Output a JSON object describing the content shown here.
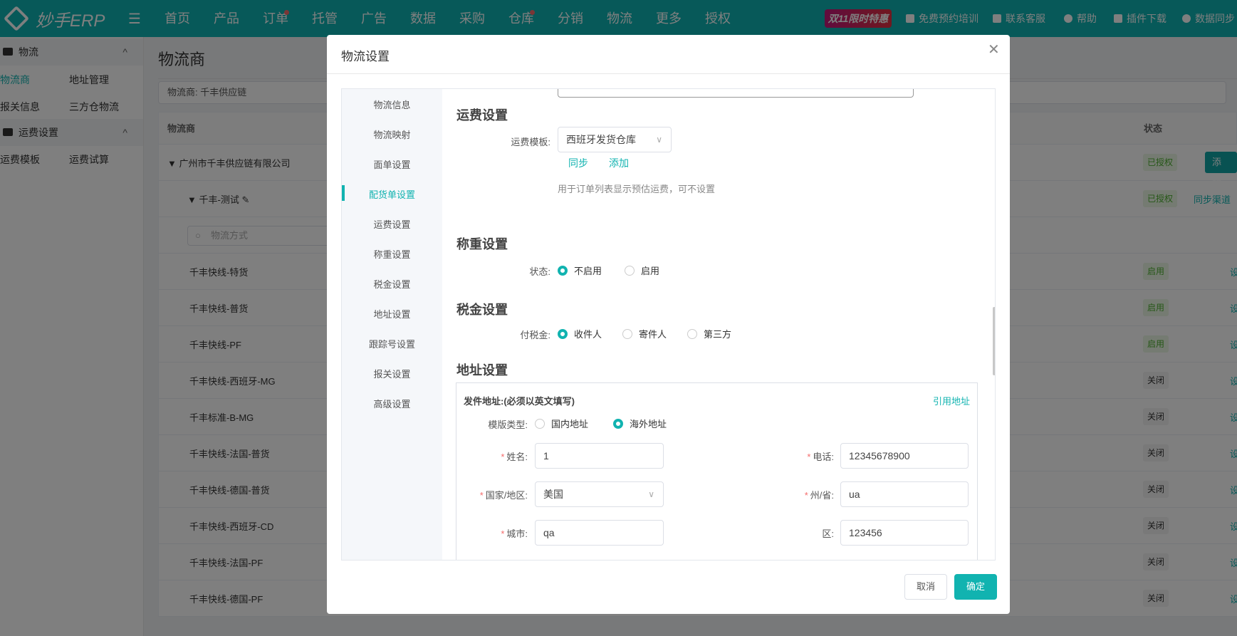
{
  "topbar": {
    "brand": "妙手ERP",
    "nav": [
      {
        "label": "首页"
      },
      {
        "label": "产品"
      },
      {
        "label": "订单",
        "dot": true
      },
      {
        "label": "托管"
      },
      {
        "label": "广告"
      },
      {
        "label": "数据"
      },
      {
        "label": "采购"
      },
      {
        "label": "仓库",
        "dot": true
      },
      {
        "label": "分销"
      },
      {
        "label": "物流"
      },
      {
        "label": "更多"
      },
      {
        "label": "授权"
      }
    ],
    "promo": "双11限时特惠",
    "links": [
      "免费预约培训",
      "联系客服",
      "帮助",
      "插件下载",
      "数据同步"
    ]
  },
  "sidebar": {
    "groups": [
      {
        "label": "物流",
        "icon": "truck-icon"
      },
      {
        "label": "运费设置",
        "icon": "truck-icon"
      }
    ],
    "items": [
      "物流商",
      "地址管理",
      "报关信息",
      "三方仓物流",
      "运费模板",
      "运费试算"
    ]
  },
  "main": {
    "title": "物流商",
    "filter": "物流商:   千丰供应链",
    "col_name": "物流商",
    "col_status": "状态",
    "company": "广州市千丰供应链有限公司",
    "company_status": "已授权",
    "add_auth": "添加授权",
    "account": "千丰-测试",
    "account_status": "已授权",
    "sync_channel": "同步渠道",
    "search_placeholder": "物流方式",
    "set_label": "设",
    "rows": [
      {
        "name": "千丰快线-特货",
        "status": "启用",
        "on": true
      },
      {
        "name": "千丰快线-普货",
        "status": "启用",
        "on": true
      },
      {
        "name": "千丰快线-PF",
        "status": "启用",
        "on": true
      },
      {
        "name": "千丰快线-西班牙-MG",
        "status": "关闭",
        "on": false
      },
      {
        "name": "千丰标准-B-MG",
        "status": "关闭",
        "on": false
      },
      {
        "name": "千丰快线-法国-普货",
        "status": "关闭",
        "on": false
      },
      {
        "name": "千丰快线-德国-普货",
        "status": "关闭",
        "on": false
      },
      {
        "name": "千丰快线-西班牙-CD",
        "status": "关闭",
        "on": false
      },
      {
        "name": "千丰快线-法国-PF",
        "status": "关闭",
        "on": false
      },
      {
        "name": "千丰快线-德国-PF",
        "status": "关闭",
        "on": false
      }
    ]
  },
  "modal": {
    "title": "物流设置",
    "nav": [
      "物流信息",
      "物流映射",
      "面单设置",
      "配货单设置",
      "运费设置",
      "称重设置",
      "税金设置",
      "地址设置",
      "跟踪号设置",
      "报关设置",
      "高级设置"
    ],
    "active_nav": 3,
    "freight": {
      "heading": "运费设置",
      "label": "运费模板:",
      "value": "西班牙发货仓库",
      "sync": "同步",
      "add": "添加",
      "hint": "用于订单列表显示预估运费，可不设置"
    },
    "weigh": {
      "heading": "称重设置",
      "label": "状态:",
      "options": [
        "不启用",
        "启用"
      ],
      "selected": 0
    },
    "tax": {
      "heading": "税金设置",
      "label": "付税金:",
      "options": [
        "收件人",
        "寄件人",
        "第三方"
      ],
      "selected": 0
    },
    "address": {
      "heading": "地址设置",
      "box_title": "发件地址:(必须以英文填写)",
      "quote": "引用地址",
      "type_label": "模版类型:",
      "type_options": [
        "国内地址",
        "海外地址"
      ],
      "type_selected": 1,
      "name_label": "姓名:",
      "name": "1",
      "phone_label": "电话:",
      "phone": "12345678900",
      "country_label": "国家/地区:",
      "country": "美国",
      "state_label": "州/省:",
      "state": "ua",
      "city_label": "城市:",
      "city": "qa",
      "district_label": "区:",
      "district": "123456"
    },
    "cancel": "取消",
    "confirm": "确定"
  }
}
